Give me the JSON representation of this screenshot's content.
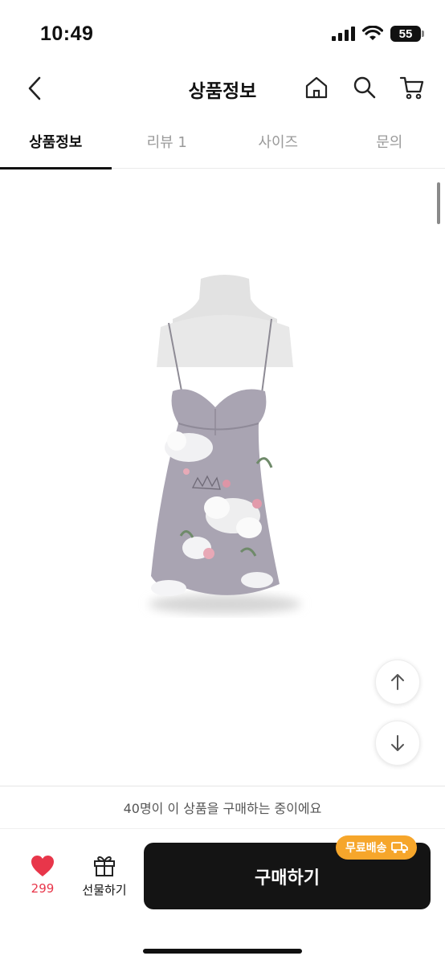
{
  "status_bar": {
    "time": "10:49",
    "battery": "55"
  },
  "header": {
    "title": "상품정보"
  },
  "tabs": [
    {
      "label": "상품정보",
      "active": true
    },
    {
      "label": "리뷰 1",
      "active": false
    },
    {
      "label": "사이즈",
      "active": false
    },
    {
      "label": "문의",
      "active": false
    }
  ],
  "product": {
    "image": "floral-slip-dress-on-mannequin"
  },
  "notice": {
    "text": "40명이 이 상품을 구매하는 중이에요"
  },
  "bottom": {
    "like_count": "299",
    "gift_label": "선물하기",
    "buy_label": "구매하기",
    "badge_label": "무료배송"
  },
  "colors": {
    "accent": "#f6a62b",
    "like": "#e8364a",
    "buy_bg": "#141414"
  },
  "icons": [
    "back-icon",
    "home-icon",
    "search-icon",
    "cart-icon",
    "arrow-up-icon",
    "arrow-down-icon",
    "heart-icon",
    "gift-icon",
    "truck-icon"
  ]
}
